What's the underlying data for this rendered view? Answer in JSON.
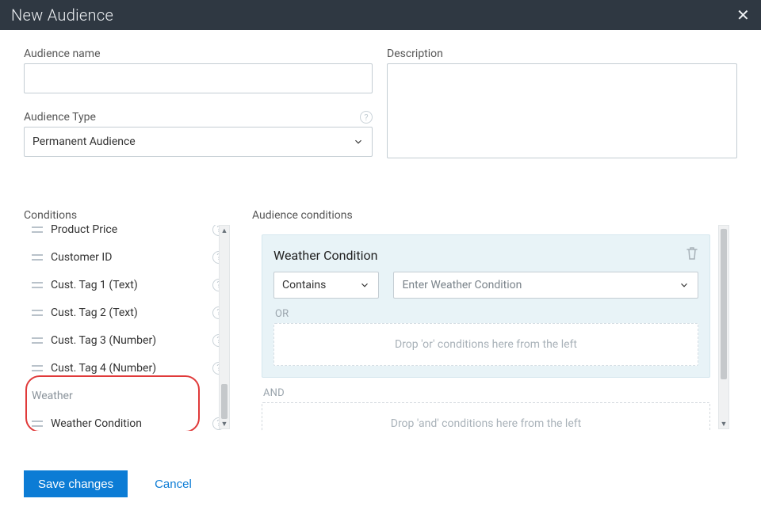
{
  "title": "New Audience",
  "form": {
    "name_label": "Audience name",
    "name_value": "",
    "desc_label": "Description",
    "desc_value": "",
    "type_label": "Audience Type",
    "type_value": "Permanent Audience"
  },
  "palette": {
    "heading": "Conditions",
    "items": [
      {
        "label": "Product Price",
        "kind": "item"
      },
      {
        "label": "Customer ID",
        "kind": "item"
      },
      {
        "label": "Cust. Tag 1 (Text)",
        "kind": "item"
      },
      {
        "label": "Cust. Tag 2 (Text)",
        "kind": "item"
      },
      {
        "label": "Cust. Tag 3 (Number)",
        "kind": "item"
      },
      {
        "label": "Cust. Tag 4 (Number)",
        "kind": "item"
      },
      {
        "label": "Weather",
        "kind": "group"
      },
      {
        "label": "Weather Condition",
        "kind": "item"
      }
    ]
  },
  "canvas": {
    "heading": "Audience conditions",
    "condition": {
      "title": "Weather Condition",
      "operator": "Contains",
      "value_placeholder": "Enter Weather Condition"
    },
    "or_label": "OR",
    "or_drop": "Drop 'or' conditions here from the left",
    "and_label": "AND",
    "and_drop": "Drop 'and' conditions here from the left"
  },
  "footer": {
    "save": "Save changes",
    "cancel": "Cancel"
  },
  "icons": {
    "help": "?",
    "close": "✕",
    "up": "▲",
    "down": "▼"
  }
}
